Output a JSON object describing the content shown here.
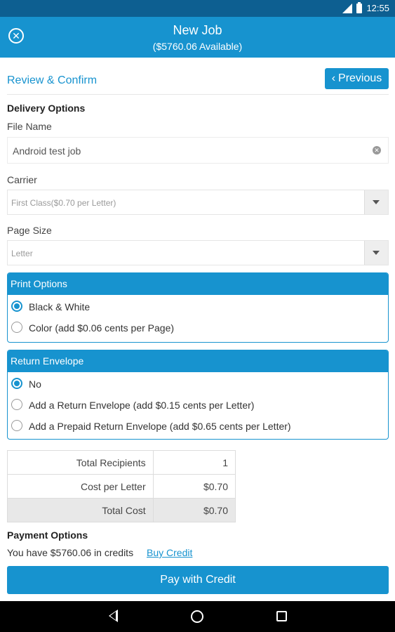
{
  "status": {
    "time": "12:55",
    "signal": "4G"
  },
  "header": {
    "title": "New Job",
    "subtitle": "($5760.06 Available)"
  },
  "review": {
    "title": "Review & Confirm",
    "previous_label": "Previous"
  },
  "delivery": {
    "heading": "Delivery Options",
    "file_name_label": "File Name",
    "file_name_value": "Android test job",
    "carrier_label": "Carrier",
    "carrier_value": "First Class($0.70 per Letter)",
    "page_size_label": "Page Size",
    "page_size_value": "Letter"
  },
  "print_options": {
    "heading": "Print Options",
    "options": [
      {
        "label": "Black & White",
        "selected": true
      },
      {
        "label": "Color (add $0.06 cents per Page)",
        "selected": false
      }
    ]
  },
  "return_envelope": {
    "heading": "Return Envelope",
    "options": [
      {
        "label": "No",
        "selected": true
      },
      {
        "label": "Add a Return Envelope (add $0.15 cents per Letter)",
        "selected": false
      },
      {
        "label": "Add a Prepaid Return Envelope (add $0.65 cents per Letter)",
        "selected": false
      }
    ]
  },
  "summary": {
    "rows": [
      {
        "label": "Total Recipients",
        "value": "1"
      },
      {
        "label": "Cost per Letter",
        "value": "$0.70"
      },
      {
        "label": "Total Cost",
        "value": "$0.70"
      }
    ]
  },
  "payment": {
    "heading": "Payment Options",
    "credits_text": "You have $5760.06 in credits",
    "buy_link": "Buy Credit",
    "pay_button": "Pay with Credit"
  },
  "colors": {
    "primary": "#1793cf",
    "statusbar": "#0d5f91"
  }
}
